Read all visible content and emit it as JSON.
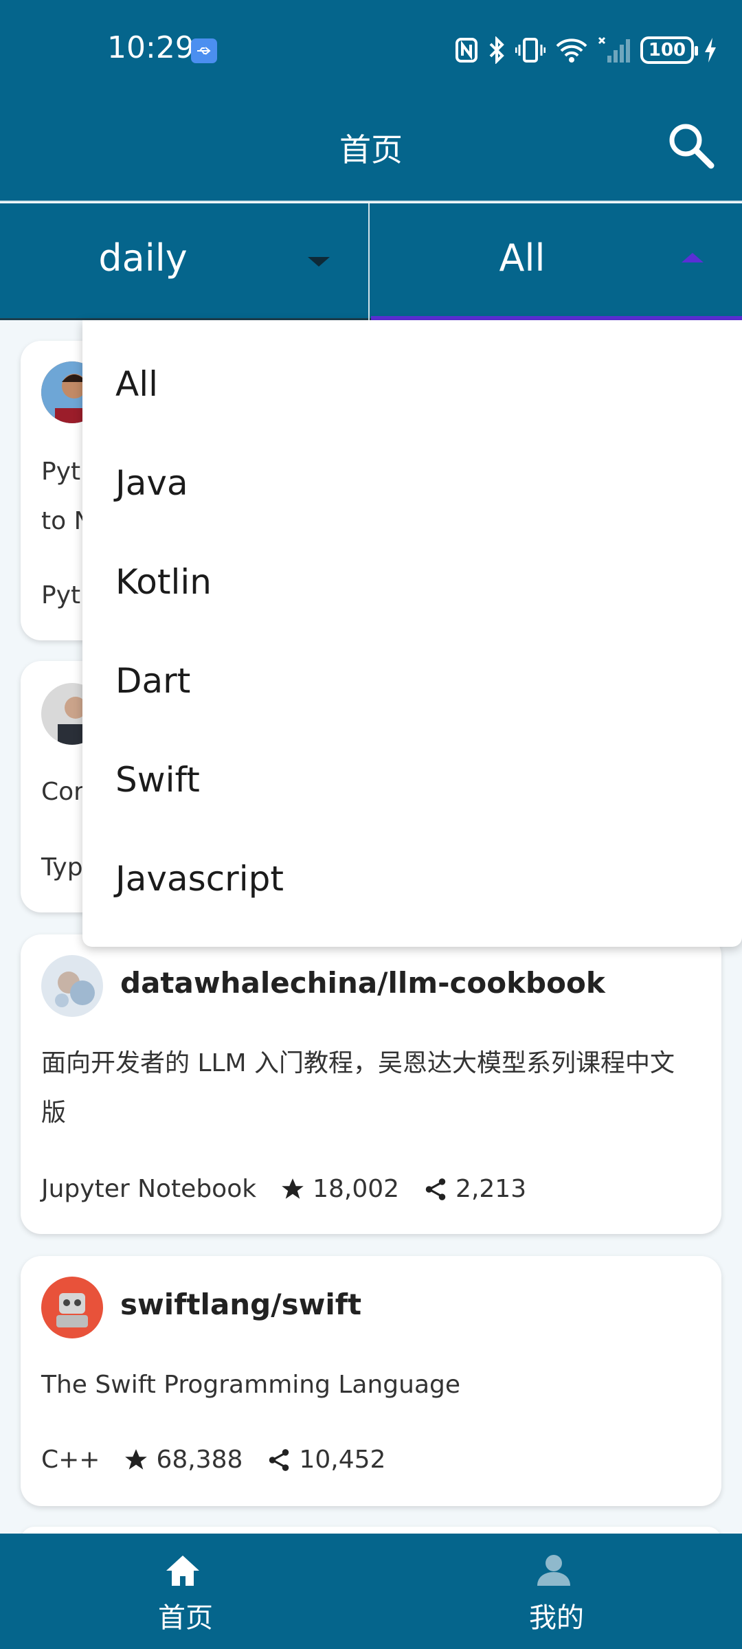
{
  "status_bar": {
    "time": "10:29",
    "battery": "100"
  },
  "app_bar": {
    "title": "首页"
  },
  "filters": {
    "period": "daily",
    "language": "All"
  },
  "dropdown": {
    "options": [
      "All",
      "Java",
      "Kotlin",
      "Dart",
      "Swift",
      "Javascript"
    ]
  },
  "cards": [
    {
      "desc_line1_partial": "Pyt",
      "desc_line2_partial": "to N",
      "lang_partial": "Pyt"
    },
    {
      "desc_partial": "Cor",
      "lang_partial": "Typ"
    },
    {
      "name": "datawhalechina/llm-cookbook",
      "description": "面向开发者的 LLM 入门教程，吴恩达大模型系列课程中文版",
      "language": "Jupyter Notebook",
      "stars": "18,002",
      "forks": "2,213"
    },
    {
      "name": "swiftlang/swift",
      "description": "The Swift Programming Language",
      "language": "C++",
      "stars": "68,388",
      "forks": "10,452"
    }
  ],
  "bottom_nav": {
    "home_label": "首页",
    "me_label": "我的"
  },
  "colors": {
    "primary": "#05658c",
    "accent": "#5b2fd6",
    "background": "#f2f7fa"
  }
}
